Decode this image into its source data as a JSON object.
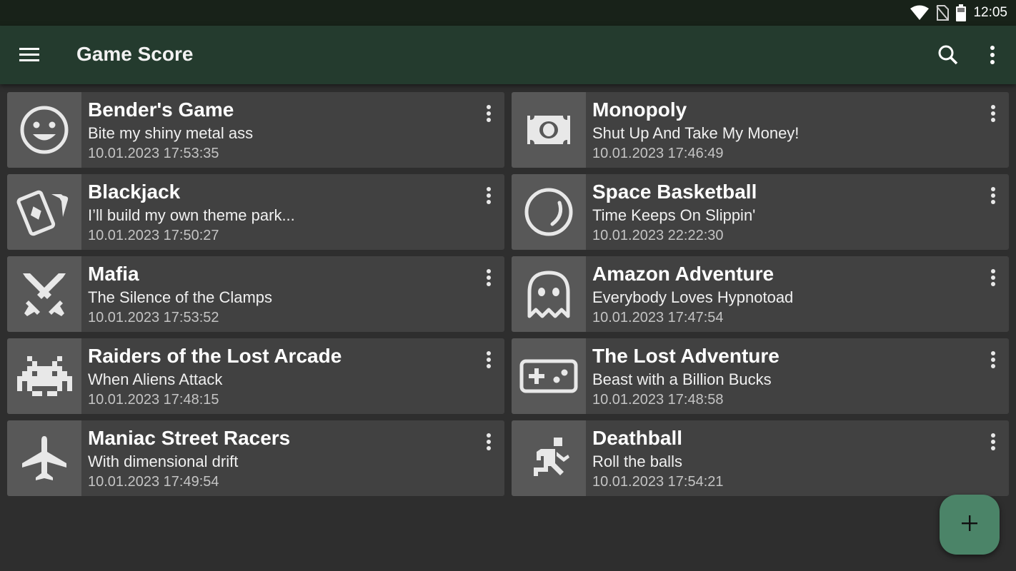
{
  "status_bar": {
    "time": "12:05",
    "icons": [
      "wifi-icon",
      "no-sim-icon",
      "battery-icon"
    ]
  },
  "app_bar": {
    "title": "Game Score",
    "icons": [
      "menu-icon",
      "search-icon",
      "more-vert-icon"
    ]
  },
  "games": [
    {
      "name": "Bender's Game",
      "description": "Bite my shiny metal ass",
      "date": "10.01.2023 17:53:35",
      "icon": "smiley-icon"
    },
    {
      "name": "Monopoly",
      "description": "Shut Up And Take My Money!",
      "date": "10.01.2023 17:46:49",
      "icon": "money-icon"
    },
    {
      "name": "Blackjack",
      "description": "I’ll build my own theme park...",
      "date": "10.01.2023 17:50:27",
      "icon": "cards-icon"
    },
    {
      "name": "Space Basketball",
      "description": "Time Keeps On Slippin'",
      "date": "10.01.2023 22:22:30",
      "icon": "ball-icon"
    },
    {
      "name": "Mafia",
      "description": "The Silence of the Clamps",
      "date": "10.01.2023 17:53:52",
      "icon": "swords-icon"
    },
    {
      "name": "Amazon Adventure",
      "description": "Everybody Loves Hypnotoad",
      "date": "10.01.2023 17:47:54",
      "icon": "ghost-icon"
    },
    {
      "name": "Raiders of the Lost Arcade",
      "description": "When Aliens Attack",
      "date": "10.01.2023 17:48:15",
      "icon": "space-invader-icon"
    },
    {
      "name": "The Lost Adventure",
      "description": "Beast with a Billion Bucks",
      "date": "10.01.2023 17:48:58",
      "icon": "gamepad-icon"
    },
    {
      "name": "Maniac Street Racers",
      "description": "With dimensional drift",
      "date": "10.01.2023 17:49:54",
      "icon": "airplane-icon"
    },
    {
      "name": "Deathball",
      "description": "Roll the balls",
      "date": "10.01.2023 17:54:21",
      "icon": "running-person-icon"
    }
  ],
  "fab": {
    "icon": "plus-icon"
  },
  "colors": {
    "status_bar": "#182219",
    "app_bar": "#243b2e",
    "background": "#2e2e2e",
    "card": "#414141",
    "thumb": "#585858",
    "fab": "#4b8468"
  }
}
